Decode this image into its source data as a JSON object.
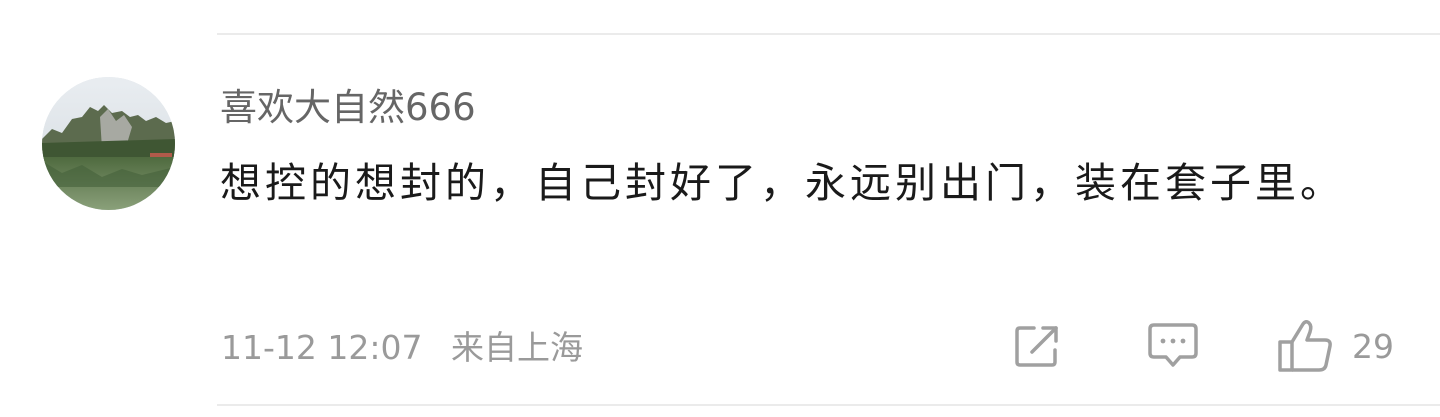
{
  "comment": {
    "username": "喜欢大自然666",
    "text": "想控的想封的，自己封好了，永远别出门，装在套子里。",
    "timestamp": "11-12 12:07",
    "location": "来自上海",
    "like_count": "29"
  },
  "actions": {
    "share_icon": "share-icon",
    "reply_icon": "comment-icon",
    "like_icon": "thumbs-up-icon"
  },
  "colors": {
    "username": "#666666",
    "text": "#1a1a1a",
    "meta": "#9a9a9a",
    "icon": "#a0a0a0",
    "divider": "#ebebeb"
  }
}
